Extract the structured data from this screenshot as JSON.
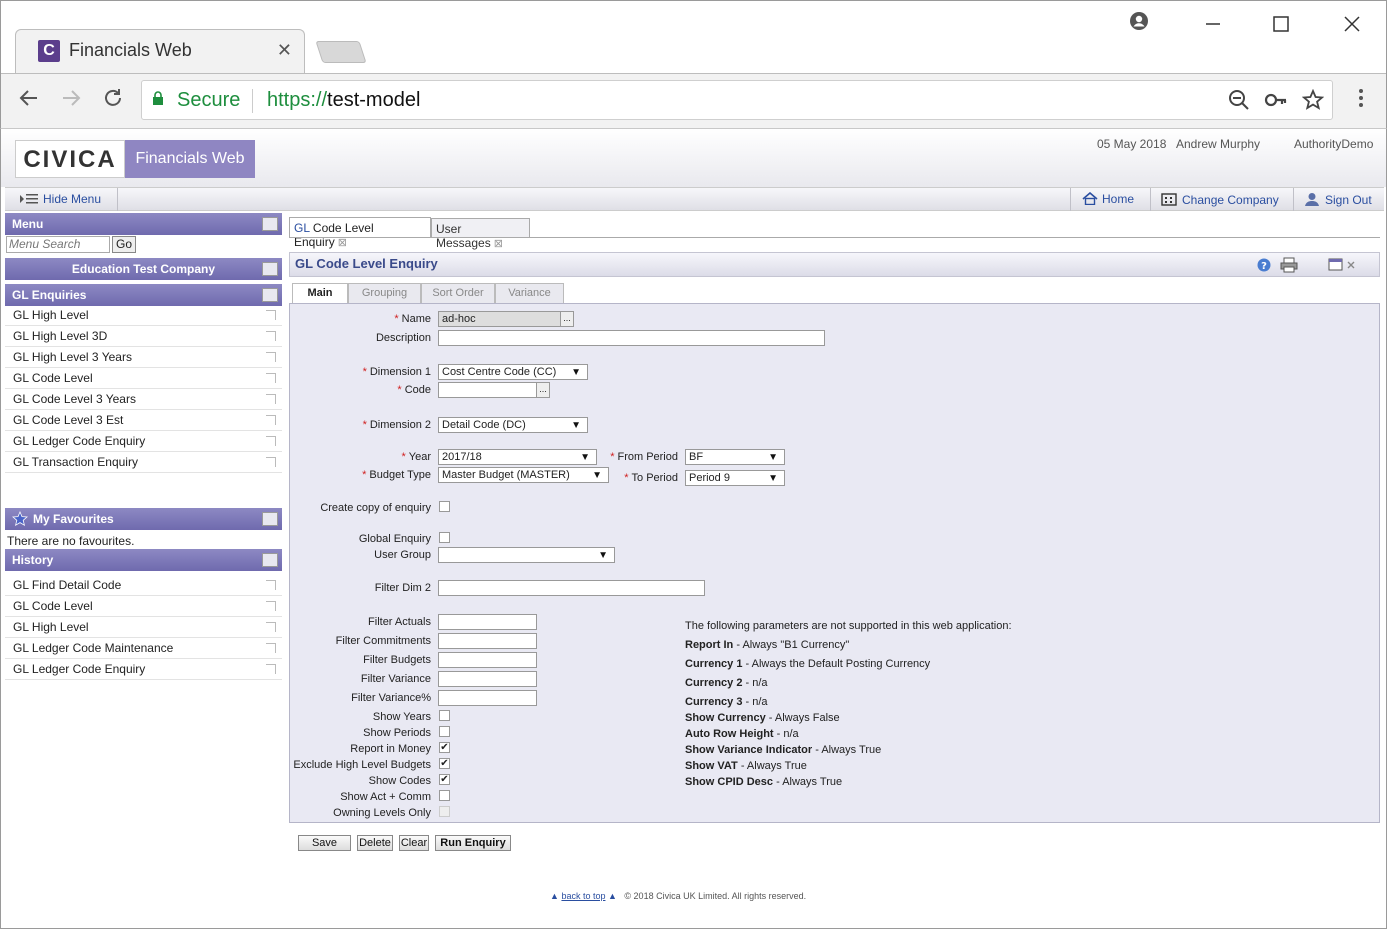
{
  "browser": {
    "tab_title": "Financials Web",
    "tab_close": "✕",
    "secure_label": "Secure",
    "url_scheme": "https://",
    "url_host": "test-model"
  },
  "header": {
    "logo_text": "CIVICA",
    "product_name": "Financials Web",
    "date": "05 May 2018",
    "user": "Andrew Murphy",
    "authority": "AuthorityDemo"
  },
  "menubar": {
    "hide_menu": "Hide Menu",
    "home": "Home",
    "change_company": "Change Company",
    "sign_out": "Sign Out"
  },
  "sidebar": {
    "menu_title": "Menu",
    "search_placeholder": "Menu Search",
    "go_label": "Go",
    "company": "Education Test Company",
    "enquiries_title": "GL Enquiries",
    "enquiries": [
      "GL High Level",
      "GL High Level 3D",
      "GL High Level 3 Years",
      "GL Code Level",
      "GL Code Level 3 Years",
      "GL Code Level 3 Est",
      "GL Ledger Code Enquiry",
      "GL Transaction Enquiry"
    ],
    "favourites_title": "My Favourites",
    "favourites_empty": "There are no favourites.",
    "history_title": "History",
    "history": [
      "GL Find Detail Code",
      "GL Code Level",
      "GL High Level",
      "GL Ledger Code Maintenance",
      "GL Ledger Code Enquiry"
    ]
  },
  "content_tabs": [
    {
      "prefix": "GL",
      "label": " Code Level Enquiry",
      "close": "⊠"
    },
    {
      "label": "User Messages",
      "close": "⊠"
    }
  ],
  "form": {
    "title": "GL Code Level Enquiry",
    "subtabs": [
      "Main",
      "Grouping",
      "Sort Order",
      "Variance"
    ],
    "labels": {
      "name": "Name",
      "description": "Description",
      "dimension1": "Dimension 1",
      "code": "Code",
      "dimension2": "Dimension 2",
      "year": "Year",
      "budget_type": "Budget Type",
      "from_period": "From Period",
      "to_period": "To Period",
      "create_copy": "Create copy of enquiry",
      "global_enquiry": "Global Enquiry",
      "user_group": "User Group",
      "filter_dim2": "Filter Dim 2",
      "filter_actuals": "Filter Actuals",
      "filter_commitments": "Filter Commitments",
      "filter_budgets": "Filter Budgets",
      "filter_variance": "Filter Variance",
      "filter_variance_pct": "Filter Variance%",
      "show_years": "Show Years",
      "show_periods": "Show Periods",
      "report_in_money": "Report in Money",
      "exclude_high_level": "Exclude High Level Budgets",
      "show_codes": "Show Codes",
      "show_act_comm": "Show Act + Comm",
      "owning_levels": "Owning Levels Only"
    },
    "values": {
      "name": "ad-hoc",
      "dimension1": "Cost Centre Code (CC)",
      "dimension2": "Detail Code (DC)",
      "year": "2017/18",
      "budget_type": "Master Budget (MASTER)",
      "from_period": "BF",
      "to_period": "Period 9"
    },
    "checkboxes": {
      "create_copy": false,
      "global_enquiry": false,
      "show_years": false,
      "show_periods": false,
      "report_in_money": true,
      "exclude_high_level": true,
      "show_codes": true,
      "show_act_comm": false,
      "owning_levels": false
    },
    "notes_intro": "The following parameters are not supported in this web application:",
    "notes": [
      {
        "k": "Report In",
        "v": " - Always \"B1 Currency\""
      },
      {
        "k": "Currency 1",
        "v": " - Always the Default Posting Currency"
      },
      {
        "k": "Currency 2",
        "v": " - n/a"
      },
      {
        "k": "Currency 3",
        "v": " - n/a"
      },
      {
        "k": "Show Currency",
        "v": " - Always False"
      },
      {
        "k": "Auto Row Height",
        "v": " - n/a"
      },
      {
        "k": "Show Variance Indicator",
        "v": " - Always True"
      },
      {
        "k": "Show VAT",
        "v": " - Always True"
      },
      {
        "k": "Show CPID Desc",
        "v": " - Always True"
      }
    ],
    "buttons": {
      "save": "Save",
      "delete": "Delete",
      "clear": "Clear",
      "run": "Run Enquiry"
    }
  },
  "footer": {
    "back_to_top": "back to top",
    "copyright": "© 2018 Civica UK Limited. All rights reserved."
  },
  "colors": {
    "accent": "#8f86c2",
    "panel_header": "#6f6aae",
    "link": "#2a4ea0",
    "secure": "#1e8e3e"
  }
}
